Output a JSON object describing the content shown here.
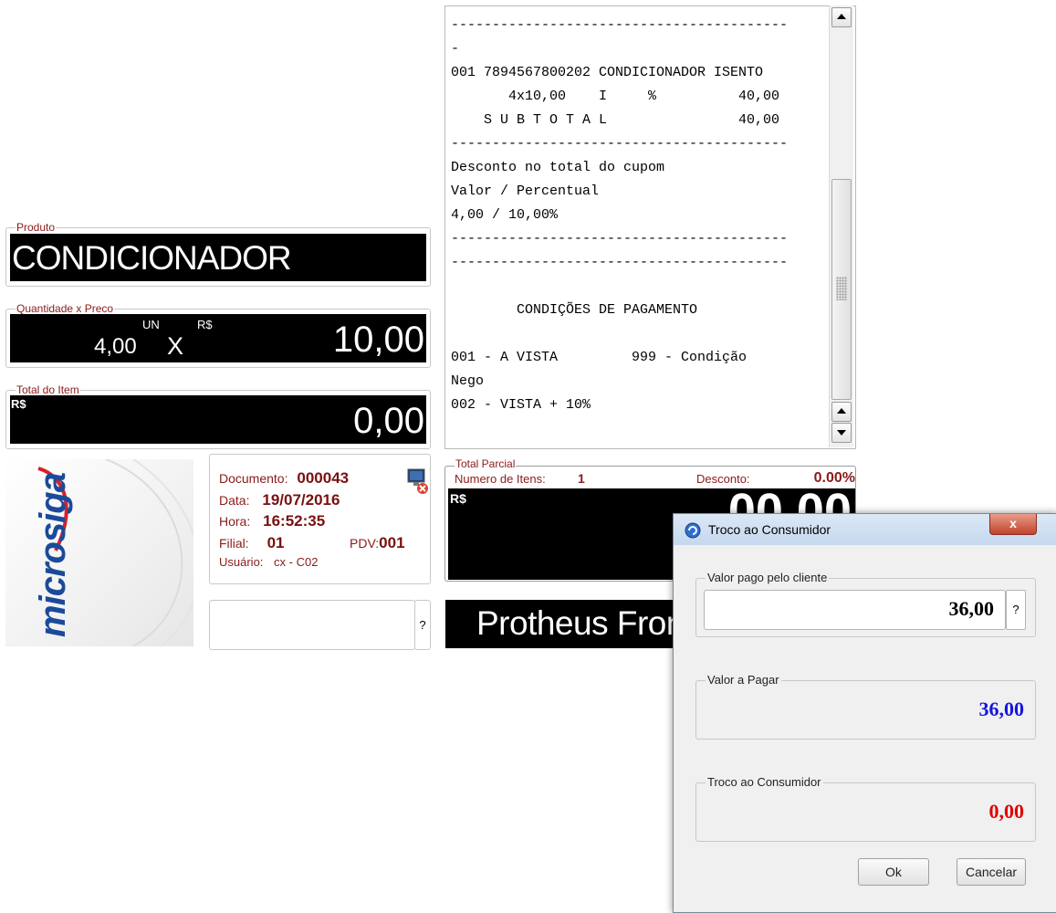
{
  "receipt": {
    "lines": [
      "-----------------------------------------",
      "-",
      "001 7894567800202 CONDICIONADOR ISENTO",
      "       4x10,00    I     %          40,00",
      "    S U B T O T A L                40,00",
      "-----------------------------------------",
      "Desconto no total do cupom",
      "Valor / Percentual",
      "4,00 / 10,00%",
      "-----------------------------------------",
      "-----------------------------------------",
      "",
      "        CONDIÇÕES DE PAGAMENTO",
      "",
      "001 - A VISTA         999 - Condição",
      "Nego",
      "002 - VISTA + 10%"
    ]
  },
  "produto": {
    "legend": "Produto",
    "value": "CONDICIONADOR"
  },
  "quantidade": {
    "legend": "Quantidade x Preco",
    "qty": "4,00",
    "unit": "UN",
    "x": "X",
    "currency": "R$",
    "price": "10,00"
  },
  "total_item": {
    "legend": "Total do Item",
    "currency": "R$",
    "value": "0,00"
  },
  "logo": {
    "text": "microsiga"
  },
  "info": {
    "documento_label": "Documento:",
    "documento": "000043",
    "data_label": "Data:",
    "data": "19/07/2016",
    "hora_label": "Hora:",
    "hora": "16:52:35",
    "filial_label": "Filial:",
    "filial": "01",
    "pdv_label": "PDV:",
    "pdv": "001",
    "usuario_label": "Usuário:",
    "usuario": "cx - C02"
  },
  "search": {
    "button": "?"
  },
  "total_parcial": {
    "legend": "Total Parcial",
    "itens_label": "Numero de Itens:",
    "itens": "1",
    "desconto_label": "Desconto:",
    "desconto": "0.00%",
    "currency": "R$",
    "value": "00,00"
  },
  "banner": {
    "text": "Protheus Front"
  },
  "dialog": {
    "title": "Troco ao Consumidor",
    "close": "x",
    "pago_label": "Valor pago pelo cliente",
    "pago_value": "36,00",
    "pago_help": "?",
    "pagar_label": "Valor a Pagar",
    "pagar_value": "36,00",
    "troco_label": "Troco ao Consumidor",
    "troco_value": "0,00",
    "ok": "Ok",
    "cancel": "Cancelar",
    "colors": {
      "pagar": "#1515e0",
      "troco": "#e00000"
    }
  }
}
